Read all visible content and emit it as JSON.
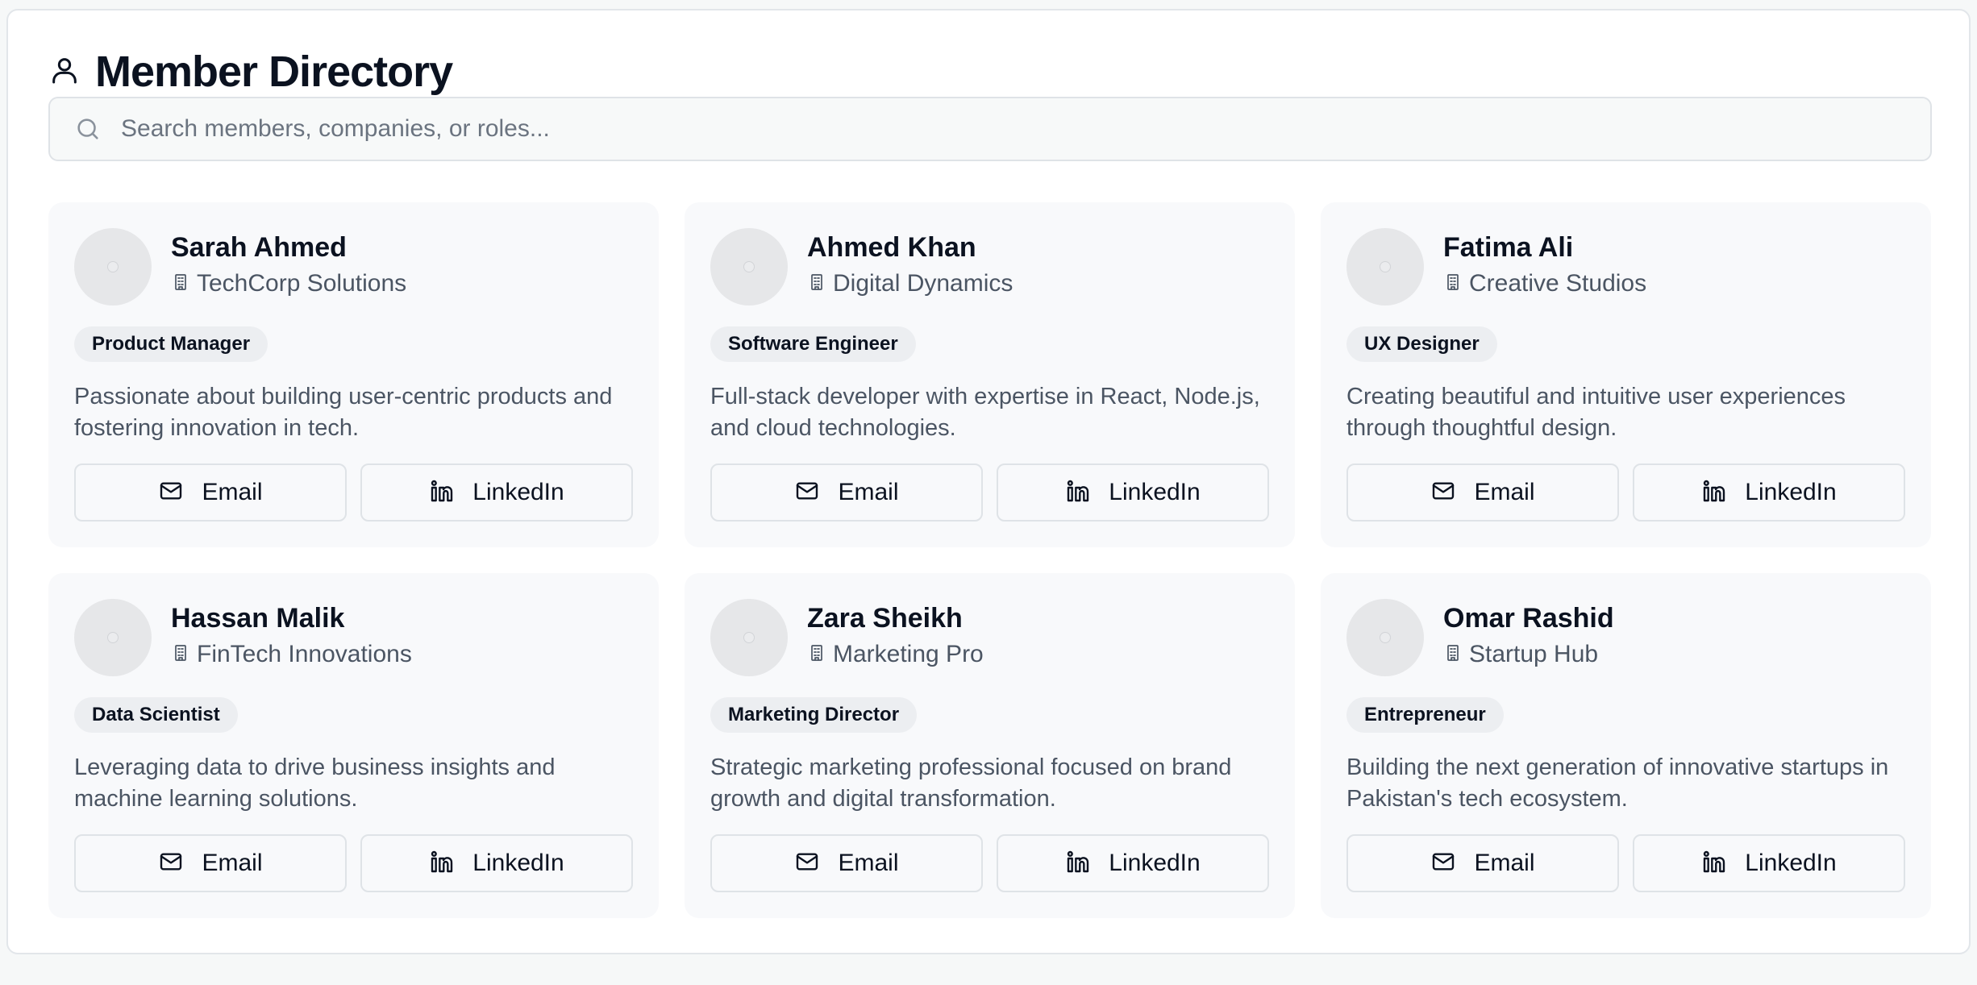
{
  "header": {
    "title": "Member Directory",
    "icon": "user-icon"
  },
  "search": {
    "placeholder": "Search members, companies, or roles...",
    "value": "",
    "icon": "search-icon"
  },
  "actions": {
    "email_label": "Email",
    "linkedin_label": "LinkedIn"
  },
  "members": [
    {
      "name": "Sarah Ahmed",
      "company": "TechCorp Solutions",
      "role": "Product Manager",
      "bio": "Passionate about building user-centric products and fostering innovation in tech."
    },
    {
      "name": "Ahmed Khan",
      "company": "Digital Dynamics",
      "role": "Software Engineer",
      "bio": "Full-stack developer with expertise in React, Node.js, and cloud technologies."
    },
    {
      "name": "Fatima Ali",
      "company": "Creative Studios",
      "role": "UX Designer",
      "bio": "Creating beautiful and intuitive user experiences through thoughtful design."
    },
    {
      "name": "Hassan Malik",
      "company": "FinTech Innovations",
      "role": "Data Scientist",
      "bio": "Leveraging data to drive business insights and machine learning solutions."
    },
    {
      "name": "Zara Sheikh",
      "company": "Marketing Pro",
      "role": "Marketing Director",
      "bio": "Strategic marketing professional focused on brand growth and digital transformation."
    },
    {
      "name": "Omar Rashid",
      "company": "Startup Hub",
      "role": "Entrepreneur",
      "bio": "Building the next generation of innovative startups in Pakistan's tech ecosystem."
    }
  ],
  "colors": {
    "text_primary": "#0b1220",
    "text_secondary": "#4b5563",
    "card_bg": "#f8f9fb",
    "border": "#dfe3e7"
  }
}
